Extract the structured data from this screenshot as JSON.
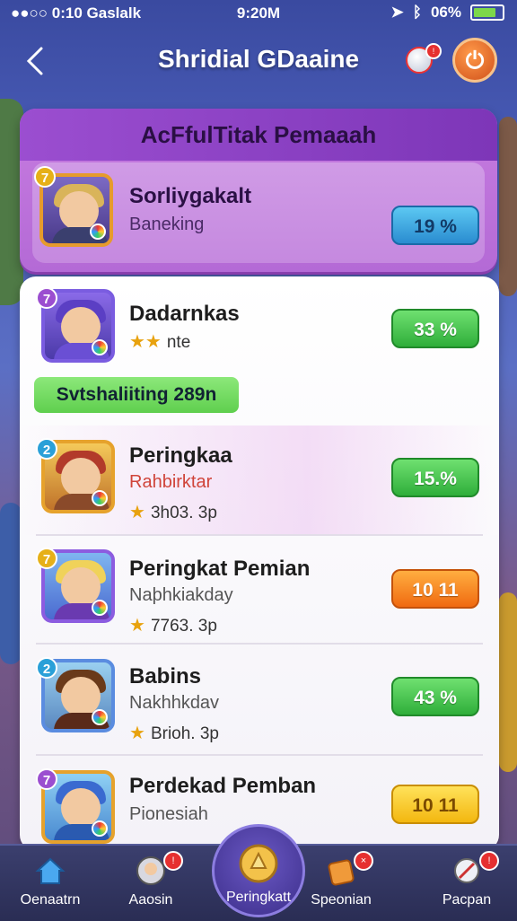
{
  "status_bar": {
    "left": "●●○○ 0:10 Gaslalk",
    "time": "9:20M",
    "battery": "06%"
  },
  "header": {
    "title": "Shridial GDaaine",
    "notif_badge": "!"
  },
  "featured": {
    "title": "AcFfulTitak Pemaaah",
    "player": {
      "name": "Sorliygakalt",
      "sub": "Baneking",
      "level": "7",
      "percent": "19 %",
      "progress": 0.19
    }
  },
  "list": {
    "banner": "Svtshaliiting 289n",
    "items": [
      {
        "level": "7",
        "name": "Dadarnkas",
        "sub": "",
        "stars_text": "nte",
        "stars": 2,
        "percent": "33 %",
        "color": "green"
      },
      {
        "level": "2",
        "name": "Peringkaa",
        "sub": "Rahbirktar",
        "stars_text": "3h03. 3p",
        "stars": 1,
        "percent": "15.%",
        "color": "green"
      },
      {
        "level": "7",
        "name": "Peringkat Pemian",
        "sub": "Naþhkiakday",
        "stars_text": "7763. 3p",
        "stars": 1,
        "percent": "10 11",
        "color": "orange"
      },
      {
        "level": "2",
        "name": "Babins",
        "sub": "Nakhhkdav",
        "stars_text": "Brioh. 3p",
        "stars": 1,
        "percent": "43 %",
        "color": "green"
      },
      {
        "level": "7",
        "name": "Perdekad Pemban",
        "sub": "Pionesiah",
        "stars_text": "",
        "stars": 0,
        "percent": "10 11",
        "color": "yellow"
      }
    ]
  },
  "nav": {
    "items": [
      {
        "label": "Oenaatrn",
        "icon": "home-icon"
      },
      {
        "label": "Aaosin",
        "icon": "avatar-icon"
      },
      {
        "label": "Peringkatt",
        "icon": "ranking-icon"
      },
      {
        "label": "Speonian",
        "icon": "shop-icon"
      },
      {
        "label": "Pacpan",
        "icon": "profile-icon"
      }
    ]
  }
}
